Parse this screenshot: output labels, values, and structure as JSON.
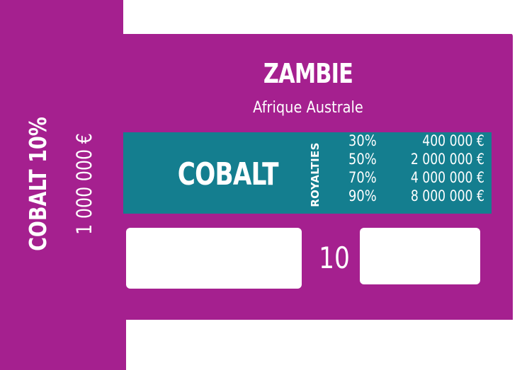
{
  "card": {
    "color": "#a5208f",
    "band_color": "#147e8f",
    "country": "ZAMBIE",
    "region": "Afrique Australe",
    "resource": "COBALT",
    "royalties_label": "ROYALTIES",
    "royalties": [
      {
        "pct": "30%",
        "amount": "400 000 €"
      },
      {
        "pct": "50%",
        "amount": "2 000 000 €"
      },
      {
        "pct": "70%",
        "amount": "4 000 000 €"
      },
      {
        "pct": "90%",
        "amount": "8 000 000 €"
      }
    ],
    "number": "10",
    "side": {
      "main": "COBALT   10%",
      "sub": "1 000 000 €"
    }
  }
}
